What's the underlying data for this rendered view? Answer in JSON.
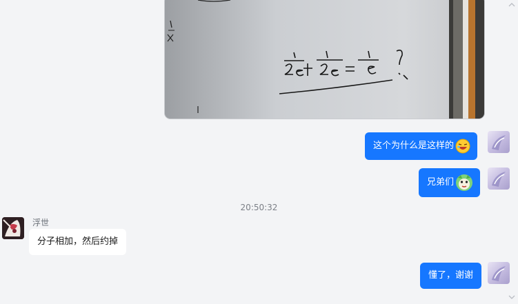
{
  "messages": [
    {
      "id": "msg-1",
      "from": "self",
      "type": "image"
    },
    {
      "id": "msg-2",
      "from": "self",
      "text": "这个为什么是这样的",
      "emoji": "laughing-emoji"
    },
    {
      "id": "msg-3",
      "from": "self",
      "text": "兄弟们",
      "emoji": "green-dragon-emoji"
    },
    {
      "id": "msg-4",
      "from": "other",
      "sender": "浮世",
      "text": "分子相加，然后约掉"
    },
    {
      "id": "msg-5",
      "from": "self",
      "text": "懂了，谢谢"
    }
  ],
  "timestamp": "20:50:32",
  "colors": {
    "self_bubble": "#1677ff",
    "other_bubble": "#ffffff",
    "background": "#f3f4f6"
  },
  "icons": {
    "scroll_up": "chevron-up-icon",
    "scroll_down": "chevron-down-icon"
  }
}
